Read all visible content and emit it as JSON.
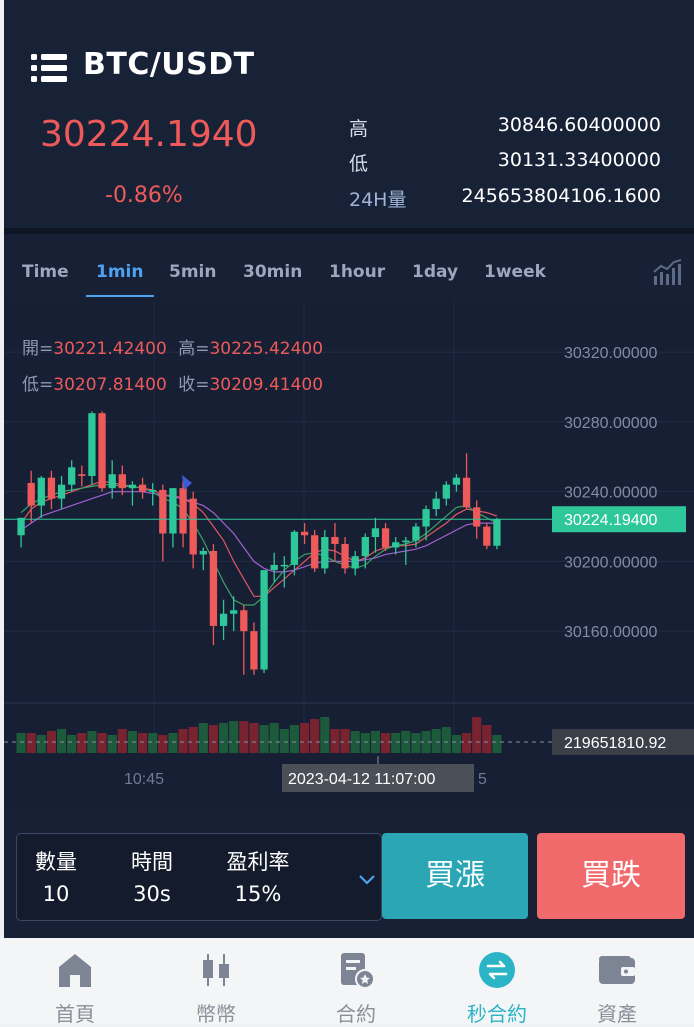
{
  "header": {
    "pair": "BTC/USDT",
    "price": "30224.1940",
    "change": "-0.86%",
    "stats": [
      {
        "label": "高",
        "value": "30846.60400000"
      },
      {
        "label": "低",
        "value": "30131.33400000"
      },
      {
        "label": "24H量",
        "value": "245653804106.1600"
      }
    ]
  },
  "tabs": [
    "Time",
    "1min",
    "5min",
    "30min",
    "1hour",
    "1day",
    "1week"
  ],
  "active_tab": "1min",
  "ohlc": {
    "open_label": "開=",
    "open": "30221.42400",
    "high_label": "高=",
    "high": "30225.42400",
    "low_label": "低=",
    "low": "30207.81400",
    "close_label": "收=",
    "close": "30209.41400"
  },
  "chart_data": {
    "type": "candlestick",
    "y_ticks": [
      "30320.00000",
      "30280.00000",
      "30240.00000",
      "30200.00000",
      "30160.00000"
    ],
    "ylim": [
      30132,
      30335
    ],
    "current_price": "30224.19400",
    "volume_label": "219651810.92",
    "x_tick": "10:45",
    "crosshair_time": "2023-04-12 11:07:00",
    "x_tick_partial": "5",
    "candles": [
      {
        "o": 30215,
        "h": 30225,
        "l": 30208,
        "c": 30225
      },
      {
        "o": 30245,
        "h": 30252,
        "l": 30222,
        "c": 30232
      },
      {
        "o": 30232,
        "h": 30249,
        "l": 30225,
        "c": 30248
      },
      {
        "o": 30248,
        "h": 30252,
        "l": 30230,
        "c": 30236
      },
      {
        "o": 30236,
        "h": 30249,
        "l": 30230,
        "c": 30244
      },
      {
        "o": 30244,
        "h": 30258,
        "l": 30240,
        "c": 30254
      },
      {
        "o": 30250,
        "h": 30255,
        "l": 30243,
        "c": 30249
      },
      {
        "o": 30249,
        "h": 30286,
        "l": 30244,
        "c": 30285
      },
      {
        "o": 30285,
        "h": 30286,
        "l": 30240,
        "c": 30242
      },
      {
        "o": 30242,
        "h": 30258,
        "l": 30236,
        "c": 30250
      },
      {
        "o": 30250,
        "h": 30255,
        "l": 30238,
        "c": 30242
      },
      {
        "o": 30242,
        "h": 30246,
        "l": 30232,
        "c": 30244
      },
      {
        "o": 30244,
        "h": 30248,
        "l": 30236,
        "c": 30240
      },
      {
        "o": 30240,
        "h": 30245,
        "l": 30232,
        "c": 30241
      },
      {
        "o": 30241,
        "h": 30244,
        "l": 30200,
        "c": 30216
      },
      {
        "o": 30216,
        "h": 30242,
        "l": 30208,
        "c": 30242
      },
      {
        "o": 30242,
        "h": 30246,
        "l": 30208,
        "c": 30216
      },
      {
        "o": 30236,
        "h": 30240,
        "l": 30196,
        "c": 30204
      },
      {
        "o": 30204,
        "h": 30208,
        "l": 30195,
        "c": 30206
      },
      {
        "o": 30206,
        "h": 30210,
        "l": 30152,
        "c": 30163
      },
      {
        "o": 30163,
        "h": 30178,
        "l": 30155,
        "c": 30170
      },
      {
        "o": 30170,
        "h": 30180,
        "l": 30160,
        "c": 30172
      },
      {
        "o": 30172,
        "h": 30175,
        "l": 30135,
        "c": 30160
      },
      {
        "o": 30160,
        "h": 30165,
        "l": 30135,
        "c": 30138
      },
      {
        "o": 30138,
        "h": 30195,
        "l": 30136,
        "c": 30195
      },
      {
        "o": 30195,
        "h": 30205,
        "l": 30188,
        "c": 30198
      },
      {
        "o": 30198,
        "h": 30203,
        "l": 30185,
        "c": 30198
      },
      {
        "o": 30198,
        "h": 30218,
        "l": 30192,
        "c": 30217
      },
      {
        "o": 30217,
        "h": 30222,
        "l": 30210,
        "c": 30215
      },
      {
        "o": 30215,
        "h": 30218,
        "l": 30194,
        "c": 30196
      },
      {
        "o": 30196,
        "h": 30218,
        "l": 30193,
        "c": 30214
      },
      {
        "o": 30214,
        "h": 30222,
        "l": 30200,
        "c": 30210
      },
      {
        "o": 30210,
        "h": 30214,
        "l": 30193,
        "c": 30196
      },
      {
        "o": 30196,
        "h": 30206,
        "l": 30192,
        "c": 30203
      },
      {
        "o": 30203,
        "h": 30216,
        "l": 30196,
        "c": 30214
      },
      {
        "o": 30214,
        "h": 30225,
        "l": 30205,
        "c": 30219
      },
      {
        "o": 30219,
        "h": 30222,
        "l": 30206,
        "c": 30208
      },
      {
        "o": 30208,
        "h": 30214,
        "l": 30204,
        "c": 30211
      },
      {
        "o": 30211,
        "h": 30214,
        "l": 30198,
        "c": 30212
      },
      {
        "o": 30212,
        "h": 30222,
        "l": 30208,
        "c": 30220
      },
      {
        "o": 30220,
        "h": 30232,
        "l": 30212,
        "c": 30230
      },
      {
        "o": 30230,
        "h": 30240,
        "l": 30226,
        "c": 30236
      },
      {
        "o": 30236,
        "h": 30246,
        "l": 30232,
        "c": 30244
      },
      {
        "o": 30244,
        "h": 30250,
        "l": 30240,
        "c": 30248
      },
      {
        "o": 30248,
        "h": 30262,
        "l": 30230,
        "c": 30231
      },
      {
        "o": 30231,
        "h": 30235,
        "l": 30213,
        "c": 30220
      },
      {
        "o": 30220,
        "h": 30222,
        "l": 30207,
        "c": 30209
      },
      {
        "o": 30209,
        "h": 30225,
        "l": 30207,
        "c": 30224
      }
    ],
    "volume": [
      0.5,
      0.5,
      0.45,
      0.55,
      0.6,
      0.45,
      0.5,
      0.55,
      0.5,
      0.45,
      0.6,
      0.55,
      0.5,
      0.5,
      0.45,
      0.5,
      0.6,
      0.65,
      0.75,
      0.7,
      0.75,
      0.8,
      0.8,
      0.75,
      0.7,
      0.75,
      0.6,
      0.7,
      0.75,
      0.85,
      0.9,
      0.6,
      0.6,
      0.55,
      0.5,
      0.55,
      0.5,
      0.5,
      0.55,
      0.5,
      0.55,
      0.6,
      0.65,
      0.45,
      0.5,
      0.9,
      0.7,
      0.45
    ],
    "ma_series": [
      {
        "values": [
          30222,
          30230,
          30234,
          30236,
          30238,
          30240,
          30242,
          30244,
          30246,
          30245,
          30244,
          30243,
          30242,
          30241,
          30238,
          30238,
          30236,
          30233,
          30228,
          30220,
          30212,
          30200,
          30190,
          30180,
          30180,
          30185,
          30190,
          30195,
          30200,
          30205,
          30207,
          30206,
          30203,
          30200,
          30202,
          30206,
          30208,
          30209,
          30209,
          30210,
          30214,
          30218,
          30222,
          30227,
          30230,
          30229,
          30228,
          30226
        ]
      },
      {
        "values": [
          30218,
          30222,
          30226,
          30228,
          30230,
          30232,
          30234,
          30236,
          30238,
          30240,
          30240,
          30240,
          30240,
          30239,
          30238,
          30237,
          30236,
          30234,
          30232,
          30228,
          30222,
          30216,
          30208,
          30200,
          30196,
          30194,
          30194,
          30195,
          30197,
          30199,
          30200,
          30200,
          30200,
          30200,
          30201,
          30202,
          30204,
          30205,
          30206,
          30207,
          30209,
          30212,
          30215,
          30218,
          30221,
          30222,
          30222,
          30222
        ]
      },
      {
        "values": [
          30228,
          30233,
          30236,
          30238,
          30240,
          30241,
          30242,
          30243,
          30244,
          30244,
          30243,
          30243,
          30242,
          30240,
          30236,
          30234,
          30230,
          30222,
          30212,
          30200,
          30188,
          30178,
          30175,
          30175,
          30180,
          30188,
          30195,
          30200,
          30204,
          30205,
          30203,
          30200,
          30198,
          30196,
          30198,
          30203,
          30207,
          30209,
          30210,
          30212,
          30216,
          30221,
          30226,
          30231,
          30232,
          30228,
          30225,
          30222
        ]
      }
    ]
  },
  "trade": {
    "qty_label": "數量",
    "qty_value": "10",
    "time_label": "時間",
    "time_value": "30s",
    "rate_label": "盈利率",
    "rate_value": "15%",
    "buy_up": "買漲",
    "buy_down": "買跌"
  },
  "nav": [
    {
      "label": "首頁",
      "icon": "home-icon"
    },
    {
      "label": "幣幣",
      "icon": "candlestick-icon"
    },
    {
      "label": "合約",
      "icon": "contract-icon"
    },
    {
      "label": "秒合約",
      "icon": "swap-icon"
    },
    {
      "label": "資產",
      "icon": "wallet-icon"
    }
  ],
  "nav_active": "秒合約",
  "colors": {
    "up": "#2ec79a",
    "down": "#ee5a5a",
    "accent": "#4ea3f0",
    "active_nav": "#2bb4c6"
  }
}
